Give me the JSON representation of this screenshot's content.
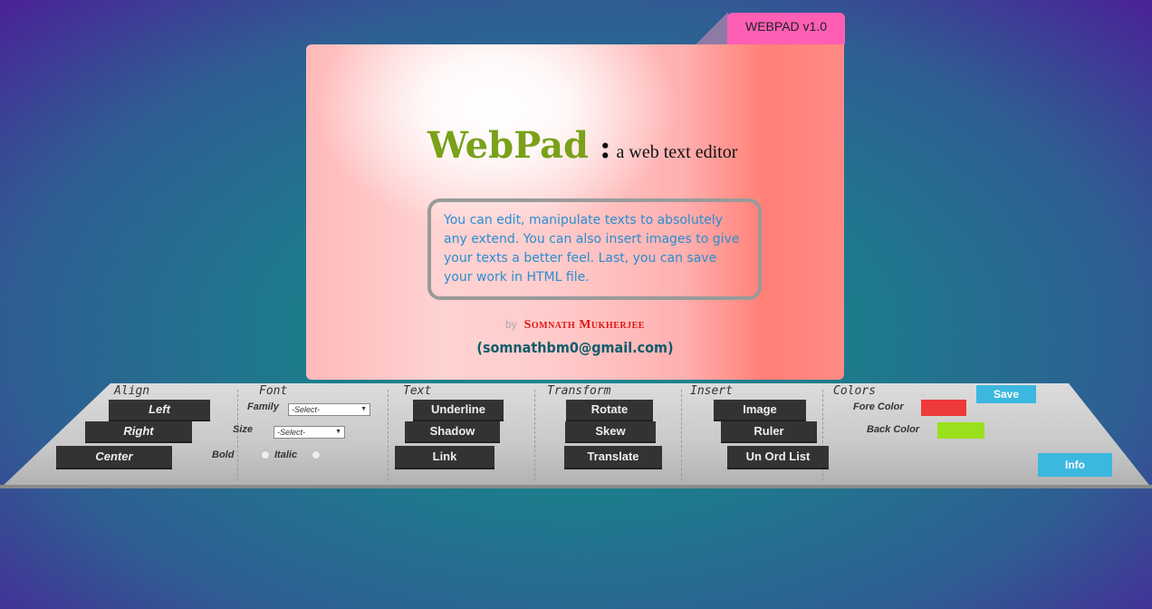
{
  "tab": {
    "label": "WEBPAD v1.0"
  },
  "card": {
    "title": "WebPad",
    "colon": ":",
    "subtitle": "a web text editor",
    "description": "You can edit, manipulate texts to absolutely any extend. You can also insert images to give your texts a better feel. Last, you can save your work in HTML file.",
    "by": "by",
    "author": "Somnath Mukherjee",
    "email": "(somnathbm0@gmail.com)"
  },
  "toolbar": {
    "align": {
      "title": "Align",
      "left": "Left",
      "right": "Right",
      "center": "Center"
    },
    "font": {
      "title": "Font",
      "family_label": "Family",
      "family_value": "-Select-",
      "size_label": "Size",
      "size_value": "-Select-",
      "bold_label": "Bold",
      "italic_label": "Italic"
    },
    "text": {
      "title": "Text",
      "underline": "Underline",
      "shadow": "Shadow",
      "link": "Link"
    },
    "transform": {
      "title": "Transform",
      "rotate": "Rotate",
      "skew": "Skew",
      "translate": "Translate"
    },
    "insert": {
      "title": "Insert",
      "image": "Image",
      "ruler": "Ruler",
      "un_ord_list": "Un Ord List"
    },
    "colors": {
      "title": "Colors",
      "fore_label": "Fore Color",
      "fore_color": "#ee3a3a",
      "back_label": "Back Color",
      "back_color": "#9be01c"
    },
    "save": "Save",
    "info": "Info"
  }
}
